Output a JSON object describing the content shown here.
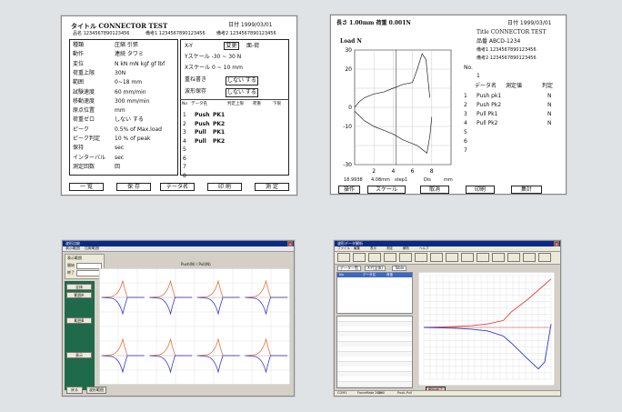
{
  "panel1": {
    "title": "タイトル CONNECTOR TEST",
    "date": "日付 1999/03/01",
    "product": "品名 1234567890123456",
    "remark1": "備考1 1234567890123456",
    "remark2": "備考2 1234567890123456",
    "settings": [
      {
        "label": "種類",
        "value": "圧縮  引張"
      },
      {
        "label": "動作",
        "value": "連続   タワミ"
      },
      {
        "label": "変位",
        "value": "N  kN  mN kgf gf lbf"
      },
      {
        "label": "荷重上限",
        "value": "30N"
      },
      {
        "label": "範囲",
        "value": "0~18 mm"
      },
      {
        "label": "試験速度",
        "value": "60 mm/min"
      },
      {
        "label": "移動速度",
        "value": "300 mm/min"
      },
      {
        "label": "原点位置",
        "value": "mm"
      },
      {
        "label": "荷重ゼロ",
        "value": "しない  する"
      },
      {
        "label": "ピーク",
        "value": "0.5% of Max.load"
      },
      {
        "label": "ピーク判定",
        "value": "10 % of peak"
      },
      {
        "label": "保持",
        "value": "sec"
      },
      {
        "label": "インターバル",
        "value": "sec"
      },
      {
        "label": "測定回数",
        "value": "回"
      }
    ],
    "xy_label": "X-Y",
    "xy_opt1": "変更",
    "xy_opt2": "面-荷",
    "yscale": "Yスケール  -30 ~ 30  N",
    "xscale": "Xスケール  0 ~ 10 mm",
    "overlay": "重ね書き",
    "overlay_val": "しない  する",
    "waveform": "波形保存",
    "waveform_val": "しない  する",
    "table_headers": [
      "No",
      "データ名",
      "判定上限",
      "荷重",
      "下限"
    ],
    "table_rows": [
      {
        "no": "1",
        "type": "Push",
        "name": "PK1"
      },
      {
        "no": "2",
        "type": "Push",
        "name": "PK2"
      },
      {
        "no": "3",
        "type": "Pull",
        "name": "PK1"
      },
      {
        "no": "4",
        "type": "Pull",
        "name": "PK2"
      },
      {
        "no": "5",
        "type": "",
        "name": ""
      },
      {
        "no": "6",
        "type": "",
        "name": ""
      },
      {
        "no": "7",
        "type": "",
        "name": ""
      },
      {
        "no": "8",
        "type": "",
        "name": ""
      }
    ],
    "buttons": [
      "一 覧",
      "保 存",
      "データ名",
      "印 刷",
      "測 定"
    ]
  },
  "panel2": {
    "header_left": "長さ 1.00mm  荷重 0.001N",
    "date": "日付 1999/03/01",
    "title": "Title CONNECTOR TEST",
    "product": "品番 ABCD-1234",
    "remark1": "備考1 1234567890123456",
    "remark2": "備考2 1234567890123456",
    "ylabel": "Load N",
    "no_label": "No.",
    "no_value": "1",
    "list_headers": [
      "データ名",
      "測定値",
      "判定"
    ],
    "list_rows": [
      {
        "no": "1",
        "name": "Push pk1",
        "unit": "N"
      },
      {
        "no": "2",
        "name": "Push Pk2",
        "unit": "N"
      },
      {
        "no": "3",
        "name": "Pull Pk1",
        "unit": "N"
      },
      {
        "no": "4",
        "name": "Pull Pk2",
        "unit": "N"
      },
      {
        "no": "5",
        "name": "",
        "unit": ""
      },
      {
        "no": "6",
        "name": "",
        "unit": ""
      },
      {
        "no": "7",
        "name": "",
        "unit": ""
      }
    ],
    "xfooter1": "18.9938",
    "xfooter2": "4.08mm",
    "xfooter3": "step1",
    "xfooter4": "Dis",
    "xfooter5": "mm",
    "buttons": [
      "操作",
      "スケール",
      "取消",
      "印刷",
      "集計"
    ]
  },
  "panel3": {
    "title": "波形比較",
    "tabs": [
      "表示範囲",
      "比較範囲"
    ],
    "toolbar_label": "表示範囲",
    "start": "開始",
    "end": "終了",
    "graph_label": "Push(N) / Pull(N)",
    "side_buttons": [
      "戻る",
      "波形範囲"
    ],
    "side_options": [
      "全体",
      "範囲A",
      "範囲B",
      "表示"
    ]
  },
  "panel4": {
    "title": "波形データ解析",
    "menu": [
      "ファイル",
      "編集",
      "表示",
      "測定",
      "解析",
      "ヘルプ"
    ],
    "tabs": [
      "データ一覧",
      "X-Y(全体)",
      "Table"
    ],
    "list_headers": [
      "No",
      "データ名",
      "荷重"
    ],
    "status": [
      "COM1",
      "ForceMate 2000",
      "Ch 0",
      "Push-Pull"
    ],
    "bottom_button": "解析終了",
    "chart_data": {
      "type": "line",
      "title": "",
      "xlabel": "",
      "ylabel": "",
      "series": [
        {
          "color": "#e04040",
          "x": [
            0,
            1,
            2,
            3,
            4,
            5,
            5.5,
            6.5,
            7.5,
            8
          ],
          "y": [
            0,
            0.2,
            0.5,
            1,
            2,
            4,
            9,
            16,
            24,
            28
          ]
        },
        {
          "color": "#2a3ad0",
          "x": [
            0,
            1,
            2,
            3,
            4,
            5,
            5.5,
            6.5,
            7.2,
            7.6,
            8
          ],
          "y": [
            0,
            -0.2,
            -0.5,
            -1,
            -2,
            -5,
            -9,
            -18,
            -24,
            -20,
            2
          ]
        }
      ],
      "xlim": [
        0,
        8
      ],
      "ylim": [
        -30,
        30
      ]
    }
  },
  "colors": {
    "background": "#dfe3e5",
    "win_title": "#0a2a8a",
    "green_panel": "#1f6a4a",
    "orange_line": "#e8703a",
    "blue_line": "#3a3ad0"
  }
}
